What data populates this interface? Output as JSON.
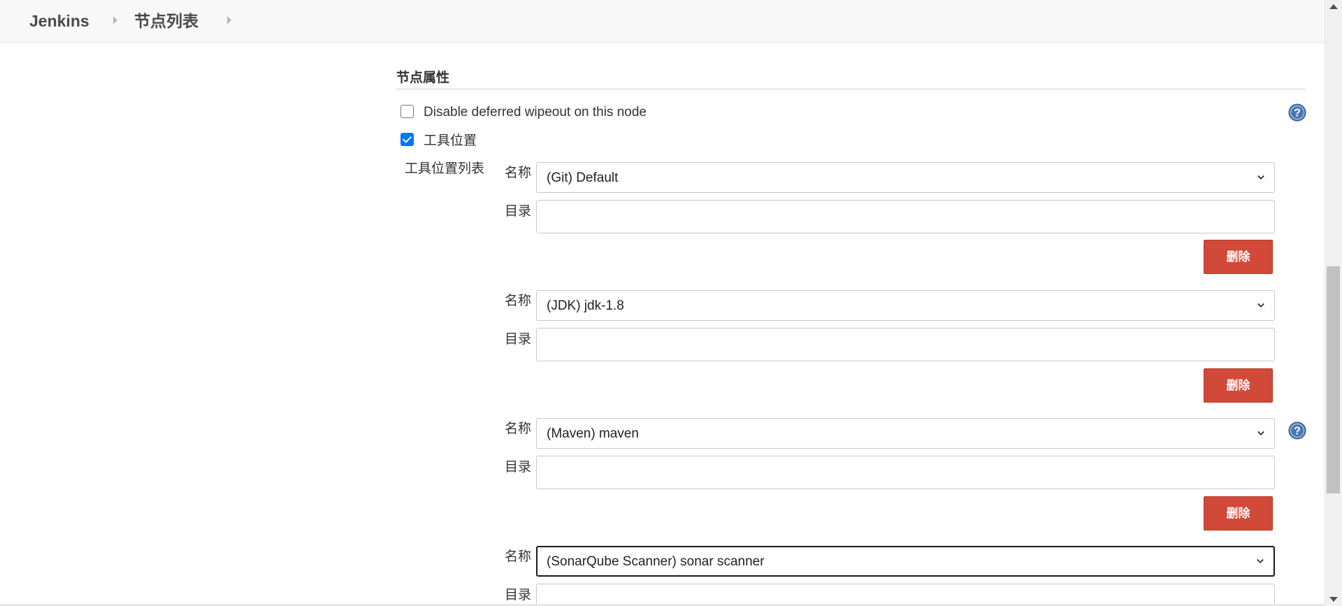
{
  "breadcrumb": {
    "items": [
      "Jenkins",
      "节点列表"
    ]
  },
  "node_properties": {
    "section_title": "节点属性",
    "disable_wipeout": {
      "label": "Disable deferred wipeout on this node",
      "checked": false
    },
    "tool_locations": {
      "label": "工具位置",
      "checked": true,
      "list_label": "工具位置列表",
      "name_label": "名称",
      "dir_label": "目录",
      "delete_label": "删除",
      "entries": [
        {
          "name": "(Git) Default",
          "directory": ""
        },
        {
          "name": "(JDK) jdk-1.8",
          "directory": ""
        },
        {
          "name": "(Maven) maven",
          "directory": ""
        },
        {
          "name": "(SonarQube Scanner) sonar scanner",
          "directory": ""
        }
      ]
    }
  },
  "icons": {
    "help": "help-icon",
    "chevron": "chevron-down-icon",
    "breadcrumb_separator": "chevron-right-icon"
  },
  "colors": {
    "delete_button": "#d24939",
    "help_icon": "#4a77b4",
    "checkbox_checked": "#0075ff"
  }
}
